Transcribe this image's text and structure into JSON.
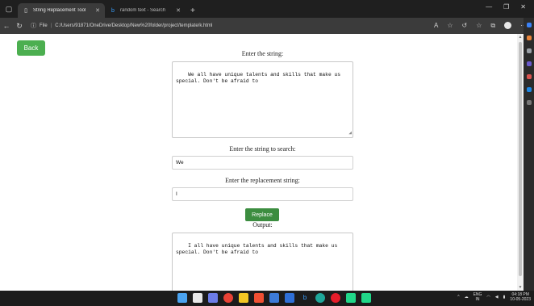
{
  "browser": {
    "tabs": [
      {
        "label": "String Replacement Tool",
        "active": true
      },
      {
        "label": "random text - Search",
        "active": false
      }
    ],
    "new_tab": "+",
    "address": {
      "file_label": "File",
      "url": "C:/Users/91871/OneDrive/Desktop/New%20folder/project/template/k.html"
    }
  },
  "page": {
    "back_label": "Back",
    "input_label": "Enter the string:",
    "input_text": "We all have unique talents and skills that make us\nspecial. Don't be afraid to",
    "search_label": "Enter the string to search:",
    "search_value": "We",
    "replacement_label": "Enter the replacement string:",
    "replacement_value": "I",
    "replace_label": "Replace",
    "output_label": "Output:",
    "output_text": "I all have unique talents and skills that make us\nspecial. Don't be afraid to"
  },
  "taskbar": {
    "lang_top": "ENG",
    "lang_bottom": "IN",
    "time": "04:18 PM",
    "date": "10-05-2023"
  },
  "colors": {
    "back_button": "#4caf50",
    "replace_button": "#3c8d40"
  }
}
